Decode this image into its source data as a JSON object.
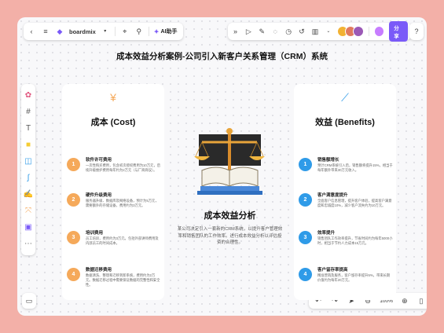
{
  "toolbar": {
    "app_name": "boardmix",
    "ai_label": "AI助手",
    "share_label": "分享",
    "avatar_colors": [
      "#f2b233",
      "#e07a5f",
      "#9b59b6"
    ]
  },
  "page_title": "成本效益分析案例-公司引入新客户关系管理（CRM）系统",
  "cost": {
    "heading": "成本 (Cost)",
    "items": [
      {
        "num": "1",
        "title": "软件许可费用",
        "desc": "一次性购买费用，包含初次授权费用为10万元，后续升级维护费用每年约为2万元（与厂商商议）。"
      },
      {
        "num": "2",
        "title": "硬件升级费用",
        "desc": "服务器升级、数据库及网络设备，预计为5万元，需要额外的存储设备，费用约为3万元。"
      },
      {
        "num": "3",
        "title": "培训费用",
        "desc": "员工培训，费用约为3万元。包括外部讲师费用及内部员工的时间成本。"
      },
      {
        "num": "4",
        "title": "数据迁移费用",
        "desc": "数据清洗、整理和迁移到新系统，费用约为2万元。数据迁移过程中需要保证数据的完整性和安全性。"
      }
    ]
  },
  "benefits": {
    "heading": "效益 (Benefits)",
    "items": [
      {
        "num": "1",
        "title": "销售额增长",
        "desc": "预计CRM系统引入后，销售额将提升15%，相当于每年额外带来30万元收入。"
      },
      {
        "num": "2",
        "title": "客户满意度提升",
        "desc": "全面客户信息管理，提升客户体验，提高客户满意度和忠诚度10%，减少客户流失约为10万元。"
      },
      {
        "num": "3",
        "title": "效率提升",
        "desc": "销售团队工作效率提升，节省时间约为每年5000小时，相当于节约人力成本15万元。"
      },
      {
        "num": "4",
        "title": "客户留存率提高",
        "desc": "精准营销及服务，客户留存率提升5%，带来长期价值约为每年20万元。"
      }
    ]
  },
  "center": {
    "title": "成本效益分析",
    "desc": "某公司决定引入一套新的CRM系统，以提升客户管理效率和销售团队的工作效率。进行成本效益分析以评估投资的合理性。"
  },
  "zoom": "100%",
  "colors": {
    "accent": "#7a5af8",
    "cost": "#f5a95a",
    "benefit": "#2f9be8"
  }
}
